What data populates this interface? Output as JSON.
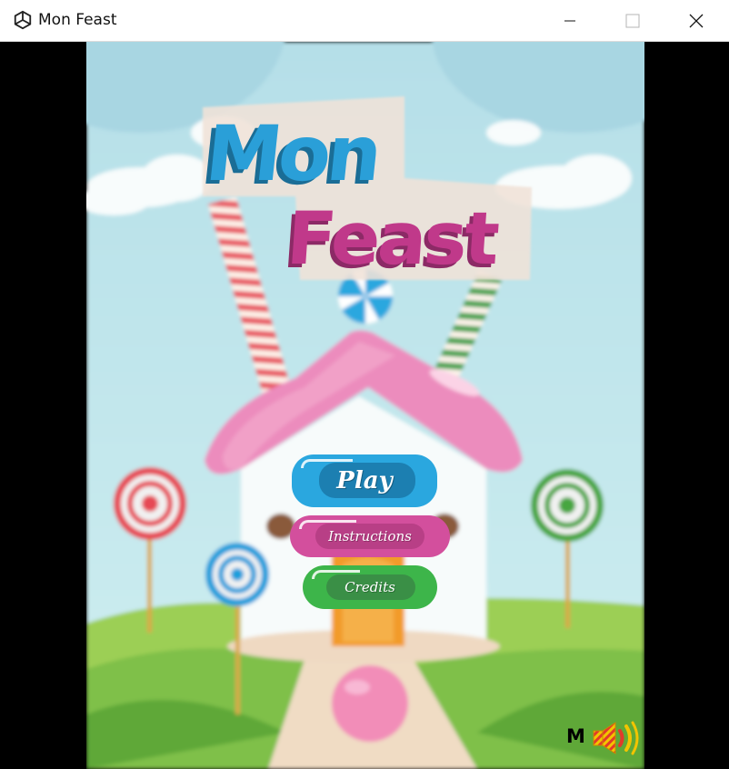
{
  "window": {
    "title": "Mon Feast",
    "app_icon": "unity-icon",
    "controls": [
      "minimize-icon",
      "maximize-icon",
      "close-icon"
    ]
  },
  "logo": {
    "line1": "Mon",
    "line2": "Feast"
  },
  "menu": {
    "play_label": "Play",
    "instructions_label": "Instructions",
    "credits_label": "Credits"
  },
  "audio": {
    "music_label": "M",
    "sound_icon": "speaker-icon"
  },
  "colors": {
    "play": "#2aa7df",
    "instructions": "#d34f9d",
    "credits": "#3db54a",
    "sky": "#bfe3ea",
    "grass": "#8cc63f",
    "roof": "#ec8cbd",
    "logo_blue": "#2a9fd8",
    "logo_pink": "#c0398a"
  }
}
